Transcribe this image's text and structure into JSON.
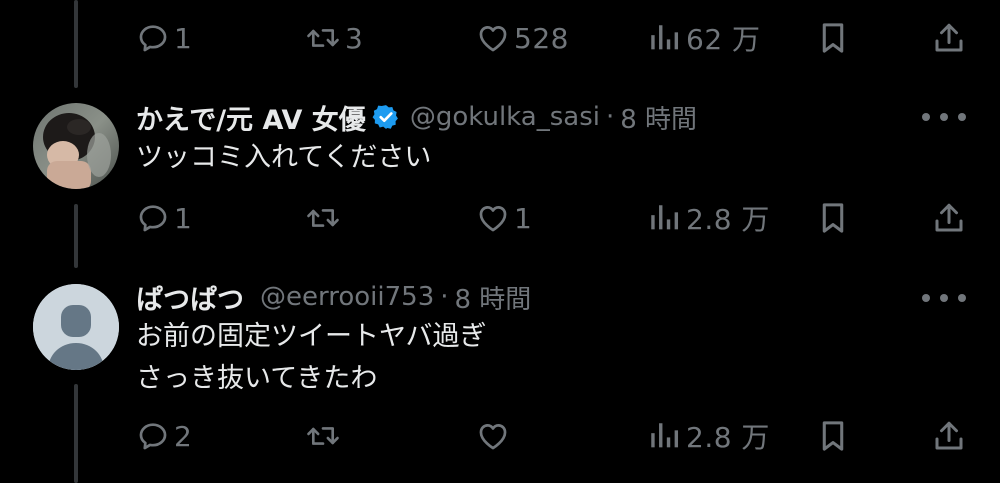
{
  "colors": {
    "background": "#000000",
    "primary_text": "#e7e9ea",
    "secondary_text": "#71767b",
    "verified_badge": "#1d9bf0",
    "thread_line": "#333639"
  },
  "top_actions": {
    "replies": "1",
    "reposts": "3",
    "likes": "528",
    "views": "62 万"
  },
  "tweets": [
    {
      "display_name": "かえで/元 AV 女優",
      "verified": true,
      "handle": "@gokulka_sasi",
      "separator": "·",
      "time": "8 時間",
      "lines": [
        "ツッコミ入れてください"
      ],
      "actions": {
        "replies": "1",
        "reposts": "",
        "likes": "1",
        "views": "2.8 万"
      }
    },
    {
      "display_name": "ぱつぱつ",
      "verified": false,
      "handle": "@eerrooii753",
      "separator": "·",
      "time": "8 時間",
      "lines": [
        "お前の固定ツイートヤバ過ぎ",
        "さっき抜いてきたわ"
      ],
      "actions": {
        "replies": "2",
        "reposts": "",
        "likes": "",
        "views": "2.8 万"
      }
    }
  ],
  "icons": {
    "reply": "reply-bubble-icon",
    "repost": "repost-arrows-icon",
    "like": "heart-icon",
    "views": "bar-chart-icon",
    "bookmark": "bookmark-icon",
    "share": "share-upload-icon",
    "more": "more-dots-icon",
    "verified": "verified-badge-icon"
  }
}
